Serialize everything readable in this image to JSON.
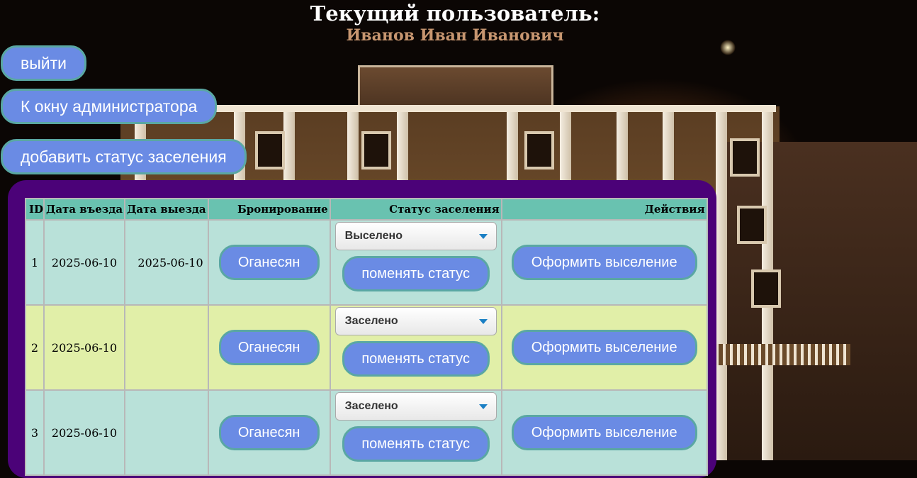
{
  "header": {
    "title": "Текущий пользователь:",
    "user_name": "Иванов Иван Иванович"
  },
  "buttons": {
    "logout": "выйти",
    "admin": "К окну администратора",
    "add_status": "добавить статус заселения"
  },
  "table": {
    "columns": [
      "ID",
      "Дата въезда",
      "Дата выезда",
      "Бронирование",
      "Статус заселения",
      "Действия"
    ],
    "rows": [
      {
        "id": "1",
        "checkin": "2025-06-10",
        "checkout": "2025-06-10",
        "booking": "Оганесян",
        "status": "Выселено",
        "change_label": "поменять статус",
        "action": "Оформить выселение"
      },
      {
        "id": "2",
        "checkin": "2025-06-10",
        "checkout": "",
        "booking": "Оганесян",
        "status": "Заселено",
        "change_label": "поменять статус",
        "action": "Оформить выселение"
      },
      {
        "id": "3",
        "checkin": "2025-06-10",
        "checkout": "",
        "booking": "Оганесян",
        "status": "Заселено",
        "change_label": "поменять статус",
        "action": "Оформить выселение"
      }
    ]
  },
  "colors": {
    "button": "#6a8be4",
    "button_border": "#5aa7a3",
    "panel": "#4b0278",
    "header_row": "#69c2b0",
    "row_odd": "#b9e1d9",
    "row_even": "#e1efa8",
    "user_name": "#c79670"
  }
}
